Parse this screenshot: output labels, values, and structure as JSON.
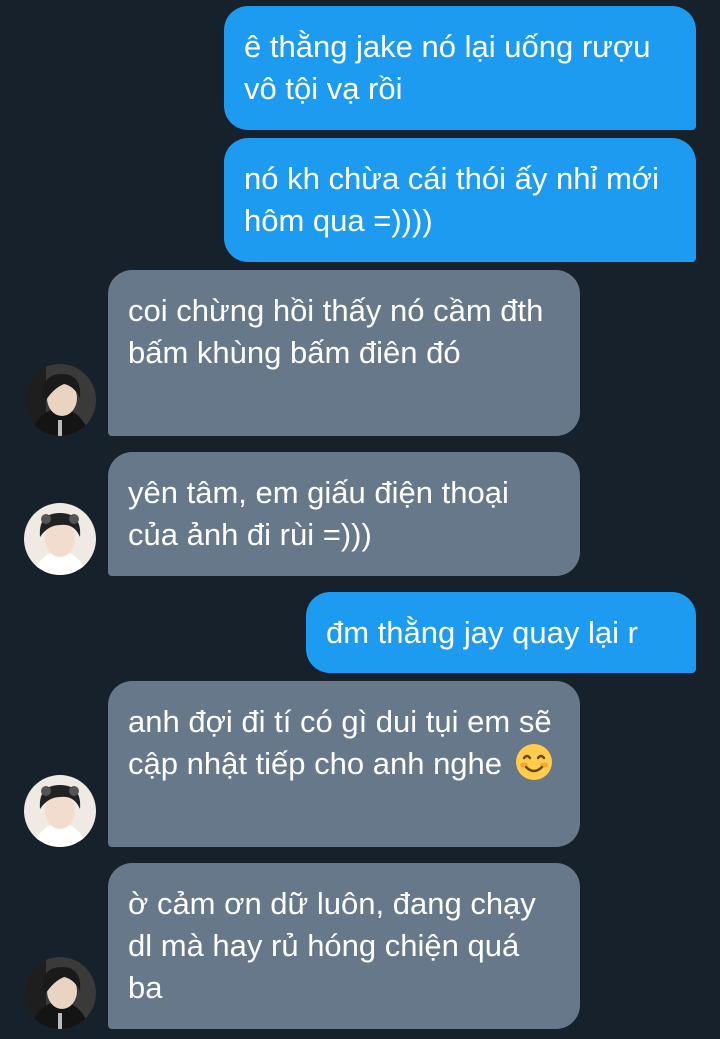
{
  "messages": [
    {
      "side": "out",
      "text": "ê thằng jake nó lại uống rượu vô tội vạ rồi"
    },
    {
      "side": "out",
      "text": "nó kh chừa cái thói ấy nhỉ mới hôm qua =))))"
    },
    {
      "side": "in",
      "avatar": "dark-avatar",
      "text": "coi chừng hồi thấy nó cầm đth bấm khùng bấm điên đó"
    },
    {
      "side": "in",
      "avatar": "light-avatar",
      "text": "yên tâm, em giấu điện thoại của ảnh đi rùi =)))"
    },
    {
      "side": "out",
      "text": "đm thằng jay quay lại r"
    },
    {
      "side": "in",
      "avatar": "light-avatar",
      "text": "anh đợi đi tí có gì dui tụi em sẽ cập nhật tiếp cho anh nghe",
      "emoji": "smiling-face-emoji"
    },
    {
      "side": "in",
      "avatar": "dark-avatar",
      "text": "ờ cảm ơn dữ luôn, đang chạy dl mà hay rủ hóng chiện quá ba"
    }
  ],
  "colors": {
    "background": "#17212c",
    "outgoing_bubble": "#1d9bf0",
    "incoming_bubble": "#66788a",
    "text": "#ffffff"
  }
}
